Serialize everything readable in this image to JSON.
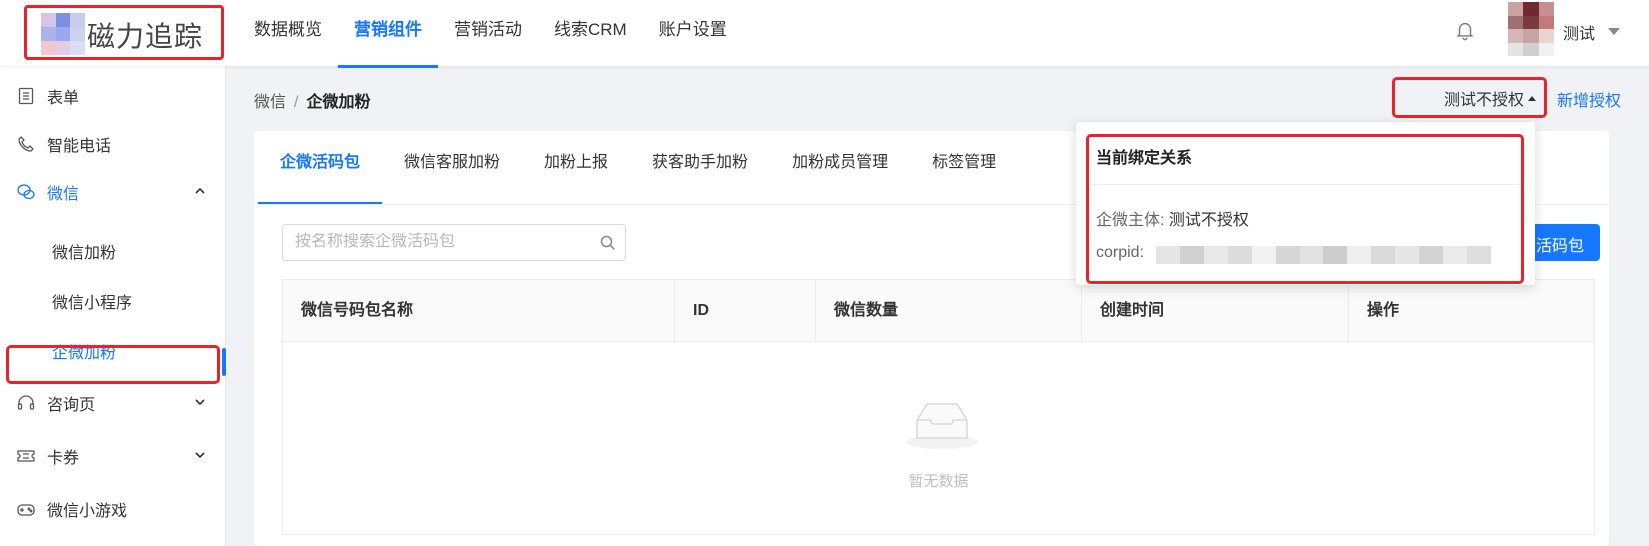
{
  "colors": {
    "accent": "#1677ff",
    "highlight_box": "#e8242a",
    "logo_mosaic": [
      "#d8c4ea",
      "#7d8fe0",
      "#c8cdea",
      "#a9b4ec",
      "#9aa8ee",
      "#cbd3f0",
      "#f0c8d0",
      "#e0cde8",
      "#d8dff4"
    ],
    "avatar_mosaic": [
      "#c9a2a2",
      "#6d2a30",
      "#c98f90",
      "#a07070",
      "#7a3b3f",
      "#c4797b",
      "#d6b6b6",
      "#c7a3a3",
      "#e9d4d4",
      "#e4e4e4",
      "#cfcfcf",
      "#f0f0f0"
    ],
    "corpid_mosaic": [
      "#e5e5e5",
      "#d0d0d0",
      "#e9e9e9",
      "#dcdcdc",
      "#f2f2f2",
      "#d6d6d6",
      "#e1e1e1",
      "#cdcdcd",
      "#efefef",
      "#dadada",
      "#e6e6e6",
      "#d3d3d3",
      "#ebebeb",
      "#dedede"
    ]
  },
  "header": {
    "logo_text": "磁力追踪",
    "nav": [
      {
        "label": "数据概览",
        "active": false
      },
      {
        "label": "营销组件",
        "active": true
      },
      {
        "label": "营销活动",
        "active": false
      },
      {
        "label": "线索CRM",
        "active": false
      },
      {
        "label": "账户设置",
        "active": false
      }
    ],
    "bell_icon": "bell-icon",
    "username": "测试"
  },
  "sidebar": {
    "items": [
      {
        "label": "表单",
        "icon": "form-icon"
      },
      {
        "label": "智能电话",
        "icon": "phone-icon"
      },
      {
        "label": "微信",
        "icon": "wechat-icon",
        "expanded": true
      },
      {
        "label": "咨询页",
        "icon": "headset-icon"
      },
      {
        "label": "卡券",
        "icon": "ticket-icon"
      },
      {
        "label": "微信小游戏",
        "icon": "gamepad-icon"
      }
    ],
    "sub_items": [
      {
        "label": "微信加粉"
      },
      {
        "label": "微信小程序"
      },
      {
        "label": "企微加粉",
        "active": true
      }
    ]
  },
  "breadcrumb": {
    "parent": "微信",
    "separator": "/",
    "current": "企微加粉"
  },
  "auth": {
    "selected": "测试不授权",
    "add_link": "新增授权"
  },
  "tabs": [
    {
      "label": "企微活码包",
      "active": true
    },
    {
      "label": "微信客服加粉"
    },
    {
      "label": "加粉上报"
    },
    {
      "label": "获客助手加粉"
    },
    {
      "label": "加粉成员管理"
    },
    {
      "label": "标签管理"
    }
  ],
  "search": {
    "placeholder": "按名称搜索企微活码包",
    "value": ""
  },
  "new_button_label": "活码包",
  "table": {
    "columns": [
      "微信号码包名称",
      "ID",
      "微信数量",
      "创建时间",
      "操作"
    ],
    "rows": [],
    "empty_text": "暂无数据"
  },
  "popover": {
    "title": "当前绑定关系",
    "entity_key": "企微主体:",
    "entity_value": "测试不授权",
    "corpid_key": "corpid:"
  }
}
